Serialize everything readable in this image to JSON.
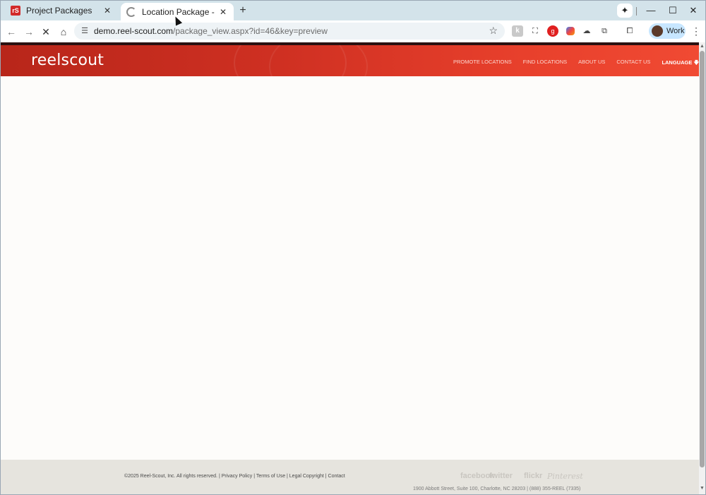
{
  "tabs": [
    {
      "title": "Project Packages",
      "favicon": "rs-logo-icon",
      "active": false
    },
    {
      "title": "Location Package - Reel-Scout",
      "favicon": "loading-spinner-icon",
      "active": true
    }
  ],
  "favicon_text": "rS",
  "toolbar": {
    "url_host": "demo.reel-scout.com",
    "url_path": "/package_view.aspx?id=46&key=preview",
    "profile_label": "Work"
  },
  "site": {
    "logo": "reelscout",
    "nav": [
      "PROMOTE LOCATIONS",
      "FIND LOCATIONS",
      "ABOUT US",
      "CONTACT US"
    ],
    "language_label": "LANGUAGE",
    "language_arrow": "🡇"
  },
  "footer": {
    "copyright": "©2025 Reel-Scout, Inc. All rights reserved. | Privacy Policy | Terms of Use | Legal Copyright | Contact",
    "social": [
      "facebook",
      "twitter",
      "flickr",
      "Pinterest"
    ],
    "address": "1900 Abbott Street, Suite 100, Charlotte, NC 28203 | (888) 355-REEL (7335)"
  },
  "colors": {
    "header_start": "#b8261a",
    "header_end": "#f04a33",
    "footer_bg": "#e6e4de",
    "tabstrip_bg": "#d3e3ea"
  }
}
